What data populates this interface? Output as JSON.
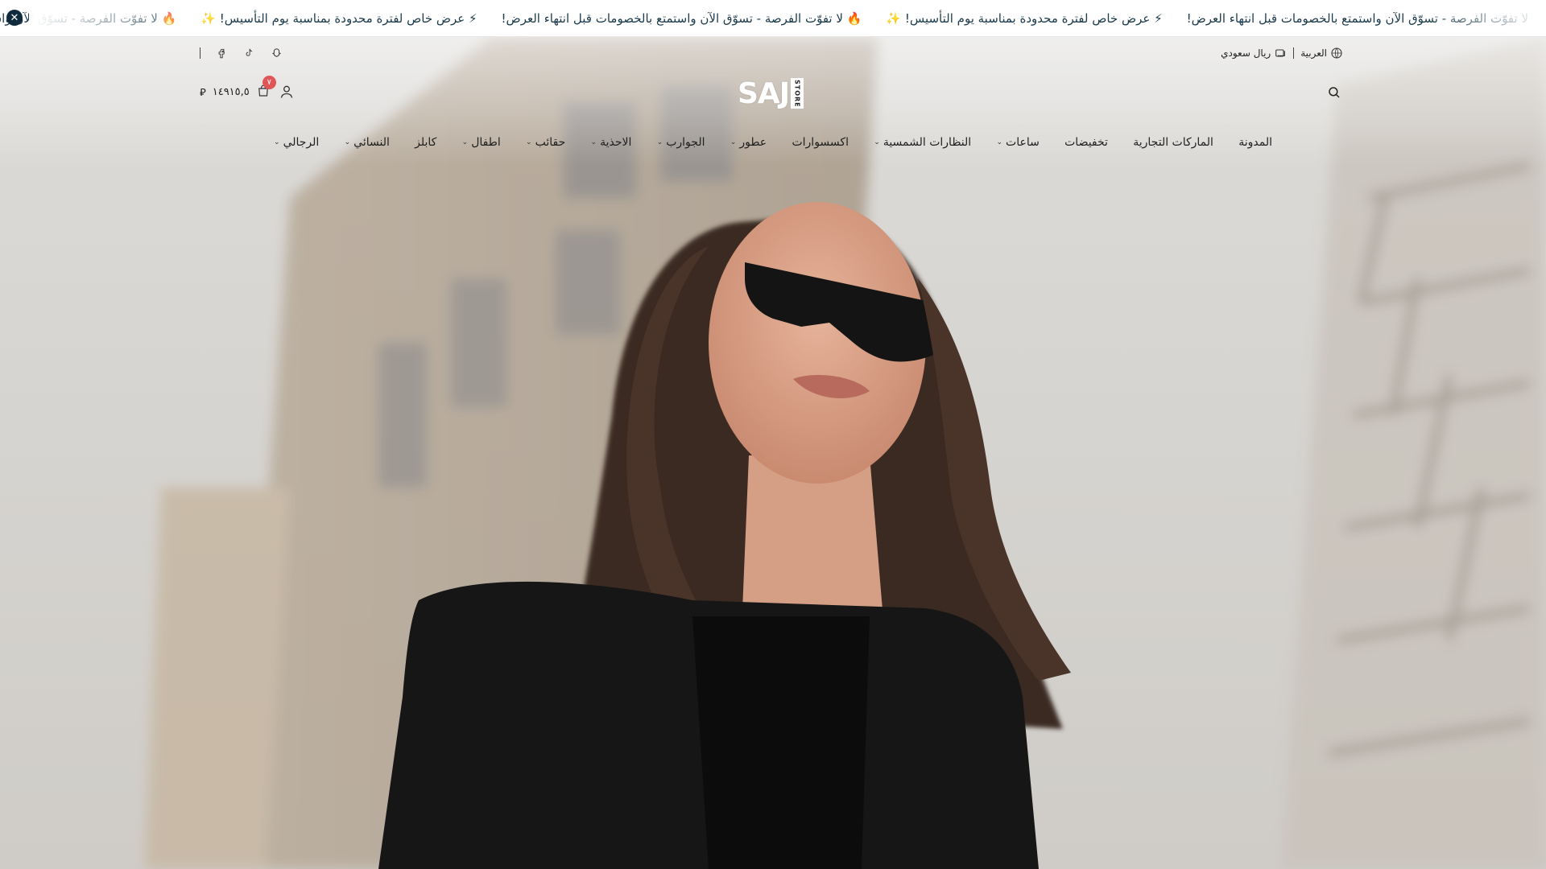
{
  "announcement": {
    "close_icon": "close-icon",
    "messages": [
      "🔥 لا تفوّت الفرصة - تسوّق الآن واستمتع بالخصومات قبل انتهاء العرض!",
      "⚡ عرض خاص لفترة محدودة بمناسبة يوم التأسيس! ✨",
      "🔥 لا تفوّت الفرصة - تسوّق الآن واستمتع بالخصومات قبل انتهاء العرض!",
      "⚡ عرض خاص لفترة محدودة بمناسبة يوم التأسيس! ✨",
      "لا تفوّت الفرصة - تسوّق الآن واستمتع بالخصومات قبل انتهاء العرض!"
    ]
  },
  "utility": {
    "language": "العربية",
    "currency": "ريال سعودي",
    "social": [
      "snapchat-icon",
      "tiktok-icon",
      "facebook-icon"
    ]
  },
  "header": {
    "logo_text": "SAJ",
    "logo_sub": "STORE",
    "cart_badge": "٧",
    "cart_total": "١٤٩١٥,٥",
    "currency_symbol": "⃁"
  },
  "nav": {
    "items": [
      {
        "label": "الرجالي",
        "dropdown": true
      },
      {
        "label": "النسائي",
        "dropdown": true
      },
      {
        "label": "كابلز",
        "dropdown": false
      },
      {
        "label": "اطفال",
        "dropdown": true
      },
      {
        "label": "حقائب",
        "dropdown": true
      },
      {
        "label": "الاحذية",
        "dropdown": true
      },
      {
        "label": "الجوارب",
        "dropdown": true
      },
      {
        "label": "عطور",
        "dropdown": true
      },
      {
        "label": "اكسسوارات",
        "dropdown": false
      },
      {
        "label": "النظارات الشمسية",
        "dropdown": true
      },
      {
        "label": "ساعات",
        "dropdown": true
      },
      {
        "label": "تخفيضات",
        "dropdown": false
      },
      {
        "label": "الماركات التجارية",
        "dropdown": false
      },
      {
        "label": "المدونة",
        "dropdown": false
      }
    ]
  },
  "colors": {
    "announcement_text": "#1b3a4b",
    "badge": "#e05656",
    "close_button": "#0f2a3d"
  }
}
